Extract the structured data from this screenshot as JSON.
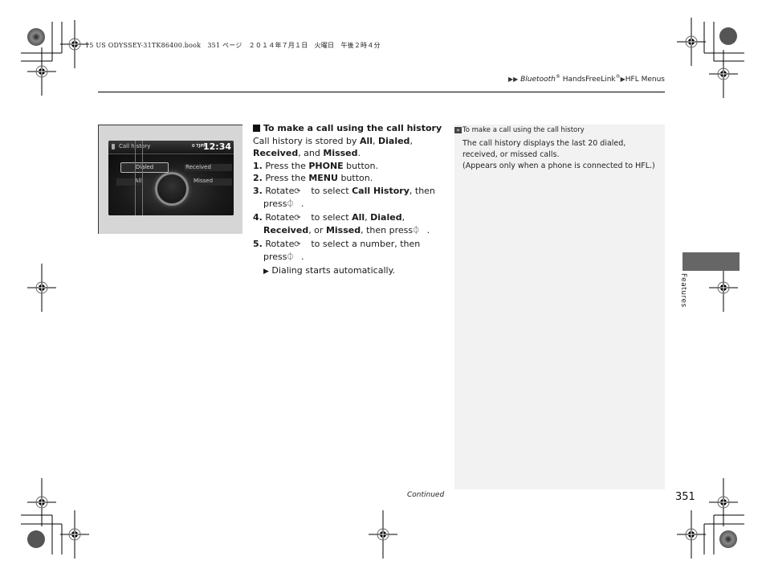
{
  "print_info": "15 US ODYSSEY-31TK86400.book　351 ページ　２０１４年７月１日　火曜日　午後２時４分",
  "breadcrumb": {
    "items": [
      "Bluetooth",
      "HandsFreeLink",
      "HFL Menus"
    ],
    "sep": "▶",
    "reg_mark": "®"
  },
  "screen": {
    "title": "Call history",
    "status": "0 TJPH",
    "clock": "12:34",
    "options": [
      "Dialed",
      "Received",
      "All",
      "Missed"
    ],
    "selected": "Dialed"
  },
  "section": {
    "heading": "To make a call using the call history",
    "intro_prefix": "Call history is stored by ",
    "intro_all": "All",
    "intro_c1": ", ",
    "intro_dialed": "Dialed",
    "intro_c2": ",",
    "intro_received": "Received",
    "intro_c3": ", and ",
    "intro_missed": "Missed",
    "intro_end": ".",
    "steps": [
      {
        "num": "1.",
        "a": "Press the ",
        "b": "PHONE",
        "c": " button."
      },
      {
        "num": "2.",
        "a": "Press the ",
        "b": "MENU",
        "c": " button."
      },
      {
        "num": "3.",
        "a": "Rotate ",
        "icon": "⟳",
        "b_pre": " to select ",
        "b": "Call History",
        "c": ", then press ",
        "press": "⏀",
        "end": "."
      },
      {
        "num": "4.",
        "a": "Rotate ",
        "icon": "⟳",
        "b_pre": " to select ",
        "o1": "All",
        "s1": ", ",
        "o2": "Dialed",
        "s2": ", ",
        "o3": "Received",
        "s3": ", or ",
        "o4": "Missed",
        "c": ", then press ",
        "press": "⏀",
        "end": "."
      },
      {
        "num": "5.",
        "a": "Rotate ",
        "icon": "⟳",
        "c": " to select a number, then press ",
        "press": "⏀",
        "end": "."
      }
    ],
    "result_marker": "▶",
    "result": "Dialing starts automatically."
  },
  "note": {
    "ref_icon": "»",
    "title": "To make a call using the call history",
    "body1": "The call history displays the last 20 dialed, received, or missed calls.",
    "body2": "(Appears only when a phone is connected to HFL.)"
  },
  "side_tab": "Features",
  "footer": {
    "continued": "Continued",
    "page_number": "351"
  }
}
